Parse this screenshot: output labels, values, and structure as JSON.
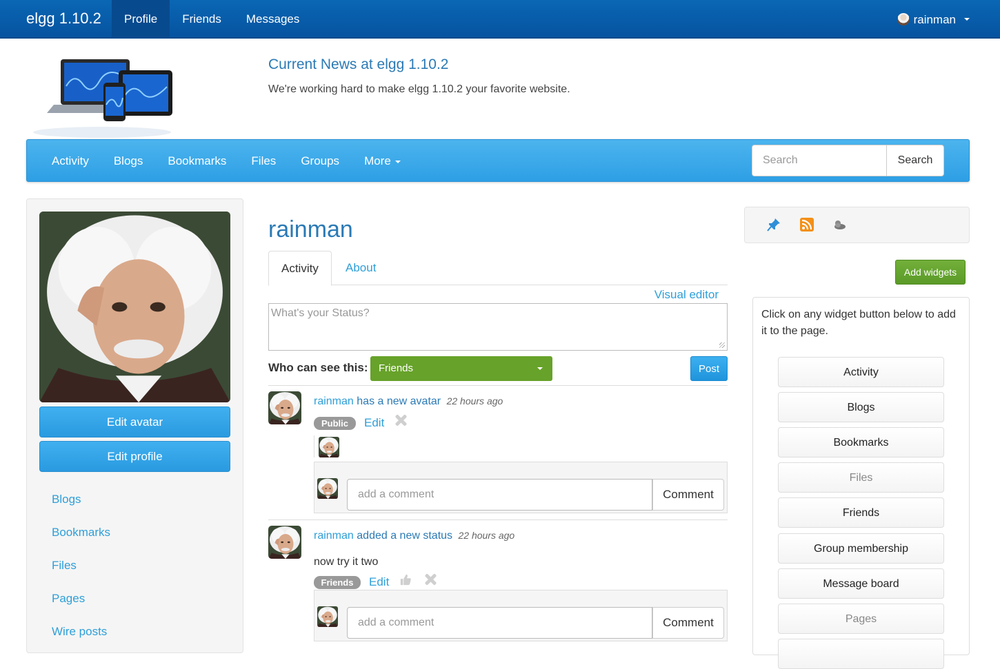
{
  "topbar": {
    "brand": "elgg 1.10.2",
    "nav": [
      {
        "label": "Profile",
        "active": true
      },
      {
        "label": "Friends",
        "active": false
      },
      {
        "label": "Messages",
        "active": false
      }
    ],
    "user": "rainman"
  },
  "header": {
    "title": "Current News at elgg 1.10.2",
    "subtitle": "We're working hard to make elgg 1.10.2 your favorite website."
  },
  "subnav": {
    "items": [
      "Activity",
      "Blogs",
      "Bookmarks",
      "Files",
      "Groups",
      "More"
    ],
    "search_placeholder": "Search",
    "search_button": "Search"
  },
  "sidebar": {
    "edit_avatar": "Edit avatar",
    "edit_profile": "Edit profile",
    "links": [
      "Blogs",
      "Bookmarks",
      "Files",
      "Pages",
      "Wire posts"
    ]
  },
  "main": {
    "username": "rainman",
    "tabs": [
      "Activity",
      "About"
    ],
    "visual_editor": "Visual editor",
    "status_placeholder": "What's your Status?",
    "who_can_see": "Who can see this:",
    "access_value": "Friends",
    "post_button": "Post",
    "river": [
      {
        "user": "rainman",
        "action": "has a new avatar",
        "time": "22 hours ago",
        "badge": "Public",
        "edit": "Edit",
        "comment_placeholder": "add a comment",
        "comment_button": "Comment"
      },
      {
        "user": "rainman",
        "action": "added a new status",
        "time": "22 hours ago",
        "body": "now try it two",
        "badge": "Friends",
        "edit": "Edit",
        "comment_placeholder": "add a comment",
        "comment_button": "Comment"
      }
    ]
  },
  "widgets": {
    "toolbar_icons": [
      "pin-icon",
      "rss-icon",
      "weather-icon"
    ],
    "add_button": "Add widgets",
    "help_text": "Click on any widget button below to add it to the page.",
    "buttons": [
      {
        "label": "Activity",
        "disabled": false
      },
      {
        "label": "Blogs",
        "disabled": false
      },
      {
        "label": "Bookmarks",
        "disabled": false
      },
      {
        "label": "Files",
        "disabled": true
      },
      {
        "label": "Friends",
        "disabled": false
      },
      {
        "label": "Group membership",
        "disabled": false
      },
      {
        "label": "Message board",
        "disabled": false
      },
      {
        "label": "Pages",
        "disabled": true
      }
    ]
  },
  "colors": {
    "topbar": "#0653a0",
    "subbar": "#2e9fe5",
    "link": "#2e9fd8",
    "heading": "#2b7ab5",
    "green": "#67a22a"
  }
}
